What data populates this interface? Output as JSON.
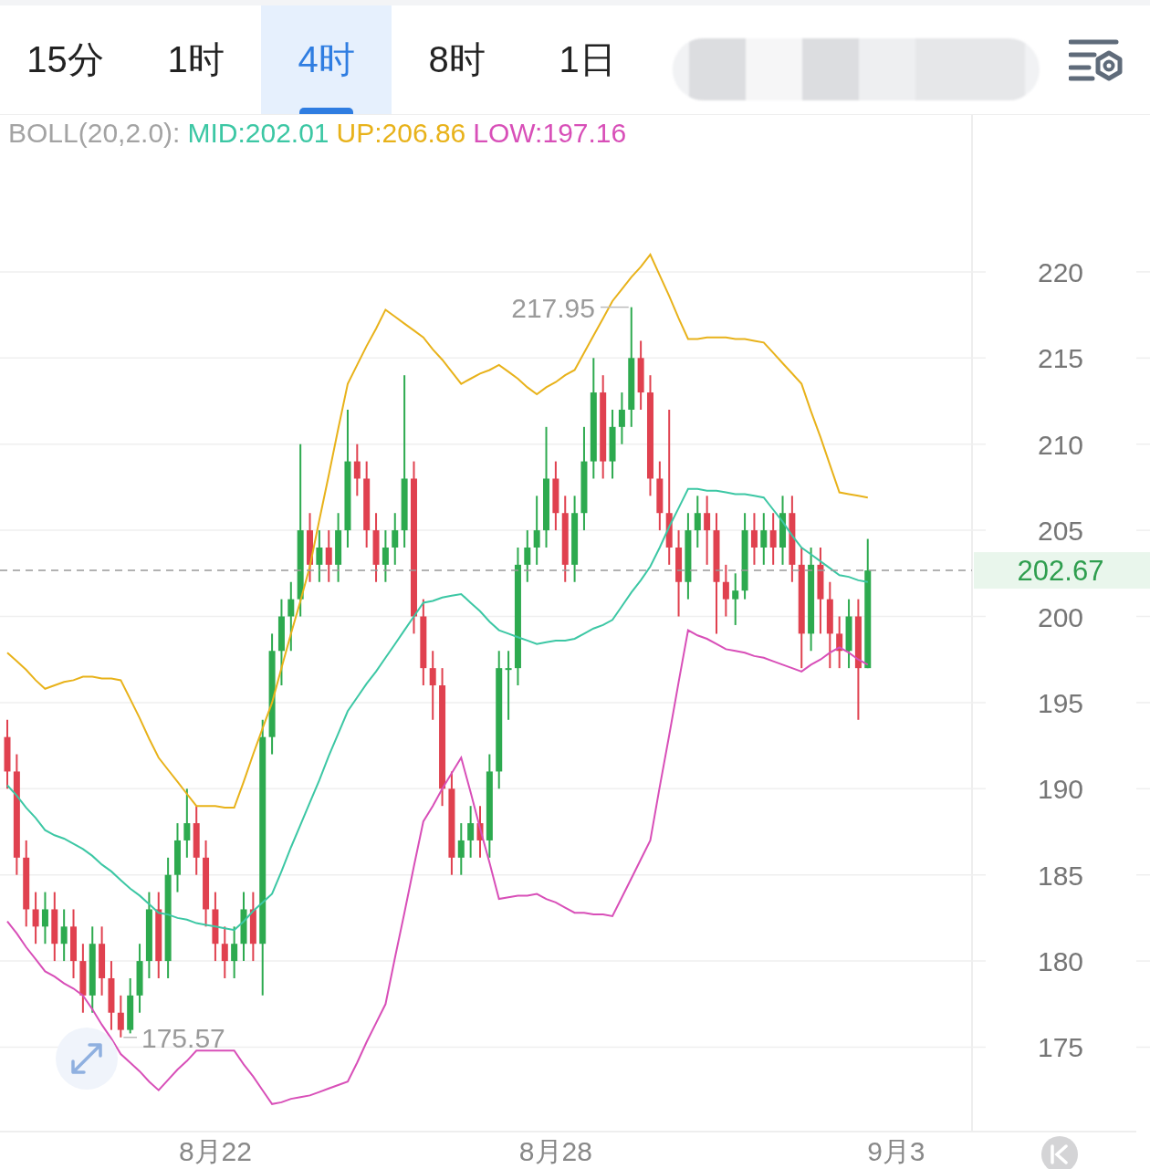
{
  "tabs": [
    {
      "label": "15分",
      "selected": false
    },
    {
      "label": "1时",
      "selected": false
    },
    {
      "label": "4时",
      "selected": true
    },
    {
      "label": "8时",
      "selected": false
    },
    {
      "label": "1日",
      "selected": false
    }
  ],
  "indicator": {
    "name": "BOLL(20,2.0):",
    "mid": "MID:202.01",
    "up": "UP:206.86",
    "low": "LOW:197.16"
  },
  "chart": {
    "high_label": "217.95",
    "low_label": "175.57",
    "chart_data": {
      "type": "candlestick",
      "ylim": [
        170.1,
        229
      ],
      "grid": true,
      "ref_lines": [
        {
          "axis": "y",
          "value": 202.67,
          "label": "202.67"
        }
      ],
      "yticks": [
        175,
        180,
        185,
        190,
        195,
        200,
        205,
        210,
        215,
        220
      ],
      "categories": [
        null,
        null,
        null,
        null,
        null,
        null,
        null,
        null,
        null,
        null,
        null,
        null,
        null,
        null,
        null,
        null,
        null,
        null,
        null,
        null,
        null,
        null,
        "8月22",
        null,
        null,
        null,
        null,
        null,
        null,
        null,
        null,
        null,
        null,
        null,
        null,
        null,
        null,
        null,
        null,
        null,
        null,
        null,
        null,
        null,
        null,
        null,
        null,
        null,
        null,
        null,
        null,
        null,
        null,
        null,
        null,
        null,
        null,
        null,
        "8月28",
        null,
        null,
        null,
        null,
        null,
        null,
        null,
        null,
        null,
        null,
        null,
        null,
        null,
        null,
        null,
        null,
        null,
        null,
        null,
        null,
        null,
        null,
        null,
        null,
        null,
        null,
        null,
        null,
        null,
        null,
        null,
        null,
        null,
        null,
        null,
        "9月3"
      ],
      "ohlc": [
        [
          193,
          194,
          190,
          191
        ],
        [
          191,
          192,
          185,
          186
        ],
        [
          186,
          187,
          182,
          183
        ],
        [
          183,
          184,
          181,
          182
        ],
        [
          182,
          184,
          181,
          183
        ],
        [
          183,
          184,
          180,
          181
        ],
        [
          181,
          183,
          180,
          182
        ],
        [
          182,
          183,
          179,
          180
        ],
        [
          180,
          181,
          177,
          178
        ],
        [
          178,
          182,
          177,
          181
        ],
        [
          181,
          182,
          178,
          179
        ],
        [
          179,
          180,
          176,
          177
        ],
        [
          177,
          178,
          175.57,
          176
        ],
        [
          176,
          179,
          175.8,
          178
        ],
        [
          178,
          181,
          177,
          180
        ],
        [
          180,
          184,
          179,
          183
        ],
        [
          183,
          184,
          179,
          180
        ],
        [
          180,
          186,
          179,
          185
        ],
        [
          185,
          188,
          184,
          187
        ],
        [
          187,
          190,
          186,
          188
        ],
        [
          188,
          189,
          185,
          186
        ],
        [
          186,
          187,
          182,
          183
        ],
        [
          183,
          184,
          180,
          181
        ],
        [
          181,
          182,
          179,
          180
        ],
        [
          180,
          182,
          179,
          181
        ],
        [
          181,
          184,
          180,
          183
        ],
        [
          183,
          184,
          180,
          181
        ],
        [
          181,
          194,
          178,
          193
        ],
        [
          193,
          199,
          192,
          198
        ],
        [
          198,
          201,
          196,
          200
        ],
        [
          200,
          202,
          198,
          201
        ],
        [
          201,
          210,
          200,
          205
        ],
        [
          205,
          206,
          202,
          203
        ],
        [
          203,
          205,
          202,
          204
        ],
        [
          204,
          205,
          202,
          203
        ],
        [
          203,
          206,
          202,
          205
        ],
        [
          205,
          212,
          204,
          209
        ],
        [
          209,
          210,
          207,
          208
        ],
        [
          208,
          209,
          204,
          205
        ],
        [
          205,
          206,
          202,
          203
        ],
        [
          203,
          205,
          202,
          204
        ],
        [
          204,
          206,
          203,
          205
        ],
        [
          205,
          214,
          204,
          208
        ],
        [
          208,
          209,
          199,
          200
        ],
        [
          200,
          201,
          196,
          197
        ],
        [
          197,
          198,
          194,
          196
        ],
        [
          196,
          197,
          189,
          190
        ],
        [
          190,
          191,
          185,
          186
        ],
        [
          186,
          188,
          185,
          187
        ],
        [
          187,
          189,
          186,
          188
        ],
        [
          188,
          189,
          186,
          187
        ],
        [
          187,
          192,
          186,
          191
        ],
        [
          191,
          198,
          190,
          197
        ],
        [
          197,
          198,
          194,
          197
        ],
        [
          197,
          204,
          196,
          203
        ],
        [
          203,
          205,
          202,
          204
        ],
        [
          204,
          207,
          203,
          205
        ],
        [
          205,
          211,
          204,
          208
        ],
        [
          208,
          209,
          205,
          206
        ],
        [
          206,
          207,
          202,
          203
        ],
        [
          203,
          207,
          202,
          206
        ],
        [
          206,
          211,
          205,
          209
        ],
        [
          209,
          215,
          208,
          213
        ],
        [
          213,
          214,
          208,
          209
        ],
        [
          209,
          212,
          208,
          211
        ],
        [
          211,
          213,
          210,
          212
        ],
        [
          212,
          217.95,
          211,
          215
        ],
        [
          215,
          216,
          212,
          213
        ],
        [
          213,
          214,
          207,
          208
        ],
        [
          208,
          209,
          205,
          206
        ],
        [
          206,
          212,
          203,
          204
        ],
        [
          204,
          205,
          200,
          202
        ],
        [
          202,
          206,
          201,
          205
        ],
        [
          205,
          207,
          204,
          206
        ],
        [
          206,
          207,
          203,
          205
        ],
        [
          205,
          206,
          199,
          202
        ],
        [
          202,
          203,
          200,
          201
        ],
        [
          201,
          202.5,
          199.5,
          201.5
        ],
        [
          201.5,
          206,
          201,
          205
        ],
        [
          205,
          206,
          203,
          204
        ],
        [
          204,
          206,
          203,
          205
        ],
        [
          205,
          206,
          203,
          204
        ],
        [
          204,
          207,
          203,
          206
        ],
        [
          206,
          207,
          202,
          203
        ],
        [
          203,
          204,
          197,
          199
        ],
        [
          199,
          204,
          198,
          203
        ],
        [
          203,
          204,
          199,
          201
        ],
        [
          201,
          202,
          197,
          199
        ],
        [
          199,
          200,
          197,
          198
        ],
        [
          198,
          201,
          197,
          200
        ],
        [
          200,
          201,
          194,
          197
        ],
        [
          197,
          204.5,
          197,
          202.67
        ],
        null,
        null,
        null
      ],
      "series": [
        {
          "type": "line",
          "color": "#e8b21a",
          "values": [
            197.9,
            197.4,
            196.9,
            196.3,
            195.8,
            196.0,
            196.2,
            196.3,
            196.5,
            196.5,
            196.4,
            196.4,
            196.3,
            195.2,
            194.1,
            192.9,
            191.8,
            191.1,
            190.4,
            189.7,
            189.0,
            189.0,
            189.0,
            188.9,
            188.9,
            190.4,
            192.0,
            193.5,
            195.0,
            197.0,
            199.0,
            200.9,
            202.9,
            205.6,
            208.2,
            210.9,
            213.5,
            214.6,
            215.7,
            216.7,
            217.8,
            217.4,
            217.0,
            216.6,
            216.2,
            215.5,
            214.9,
            214.2,
            213.5,
            213.8,
            214.1,
            214.3,
            214.6,
            214.2,
            213.8,
            213.3,
            212.9,
            213.3,
            213.6,
            214.0,
            214.3,
            215.3,
            216.3,
            217.3,
            218.3,
            219.0,
            219.7,
            220.3,
            221.0,
            219.8,
            218.6,
            217.3,
            216.1,
            216.1,
            216.2,
            216.2,
            216.2,
            216.1,
            216.1,
            216.0,
            215.9,
            215.3,
            214.7,
            214.1,
            213.5,
            211.9,
            210.4,
            208.8,
            207.2,
            207.1,
            207.0,
            206.9,
            null,
            null,
            null
          ]
        },
        {
          "type": "line",
          "color": "#3cc7a4",
          "values": [
            190.2,
            189.6,
            188.9,
            188.3,
            187.6,
            187.3,
            187.1,
            186.8,
            186.5,
            186.1,
            185.6,
            185.2,
            184.7,
            184.2,
            183.8,
            183.3,
            182.8,
            182.7,
            182.5,
            182.4,
            182.2,
            182.1,
            182.0,
            181.9,
            181.8,
            182.3,
            182.9,
            183.4,
            183.9,
            185.2,
            186.6,
            187.9,
            189.2,
            190.5,
            191.9,
            193.2,
            194.5,
            195.3,
            196.1,
            196.8,
            197.6,
            198.4,
            199.2,
            200.0,
            200.8,
            200.9,
            201.1,
            201.2,
            201.3,
            200.8,
            200.3,
            199.7,
            199.2,
            199.0,
            198.8,
            198.6,
            198.4,
            198.5,
            198.6,
            198.6,
            198.7,
            199.0,
            199.3,
            199.5,
            199.8,
            200.6,
            201.4,
            202.1,
            202.9,
            204.0,
            205.2,
            206.3,
            207.4,
            207.4,
            207.3,
            207.3,
            207.2,
            207.1,
            207.1,
            207.0,
            206.9,
            206.2,
            205.5,
            204.7,
            204.0,
            203.6,
            203.2,
            202.8,
            202.4,
            202.3,
            202.1,
            202.0,
            null,
            null,
            null
          ]
        },
        {
          "type": "line",
          "color": "#d84fb8",
          "values": [
            182.3,
            181.6,
            180.8,
            180.1,
            179.4,
            179.1,
            178.7,
            178.4,
            178.0,
            177.2,
            176.3,
            175.5,
            174.6,
            174.1,
            173.6,
            173.0,
            172.5,
            173.1,
            173.7,
            174.2,
            174.8,
            174.8,
            174.8,
            174.8,
            174.8,
            174.0,
            173.3,
            172.5,
            171.7,
            171.8,
            172.0,
            172.1,
            172.2,
            172.4,
            172.6,
            172.8,
            173.0,
            174.1,
            175.3,
            176.4,
            177.5,
            180.2,
            182.8,
            185.5,
            188.1,
            189.0,
            190.0,
            190.9,
            191.8,
            189.8,
            187.7,
            185.7,
            183.6,
            183.7,
            183.8,
            183.8,
            183.9,
            183.6,
            183.4,
            183.1,
            182.8,
            182.8,
            182.7,
            182.7,
            182.6,
            183.7,
            184.8,
            185.9,
            187.0,
            190.1,
            193.1,
            196.2,
            199.2,
            198.9,
            198.7,
            198.4,
            198.1,
            198.0,
            197.9,
            197.7,
            197.6,
            197.4,
            197.2,
            197.0,
            196.8,
            197.2,
            197.5,
            197.9,
            198.2,
            197.9,
            197.5,
            197.2,
            null,
            null,
            null
          ]
        }
      ]
    }
  }
}
